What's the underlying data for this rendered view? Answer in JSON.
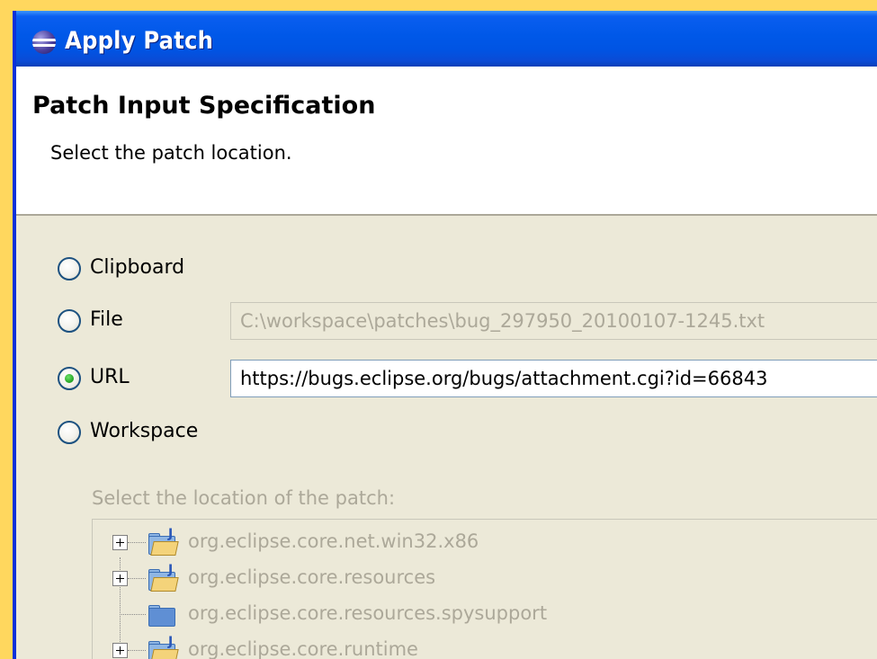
{
  "window": {
    "title": "Apply Patch"
  },
  "banner": {
    "title": "Patch Input Specification",
    "description": "Select the patch location."
  },
  "source_options": [
    {
      "label": "Clipboard",
      "selected": false
    },
    {
      "label": "File",
      "selected": false
    },
    {
      "label": "URL",
      "selected": true
    },
    {
      "label": "Workspace",
      "selected": false
    }
  ],
  "file_field": {
    "value": "C:\\workspace\\patches\\bug_297950_20100107-1245.txt",
    "enabled": false
  },
  "url_field": {
    "value": "https://bugs.eclipse.org/bugs/attachment.cgi?id=66843",
    "enabled": true
  },
  "workspace_tree": {
    "label": "Select the location of the patch:",
    "items": [
      {
        "name": "org.eclipse.core.net.win32.x86",
        "expandable": true
      },
      {
        "name": "org.eclipse.core.resources",
        "expandable": true
      },
      {
        "name": "org.eclipse.core.resources.spysupport",
        "expandable": false
      },
      {
        "name": "org.eclipse.core.runtime",
        "expandable": true
      }
    ]
  }
}
